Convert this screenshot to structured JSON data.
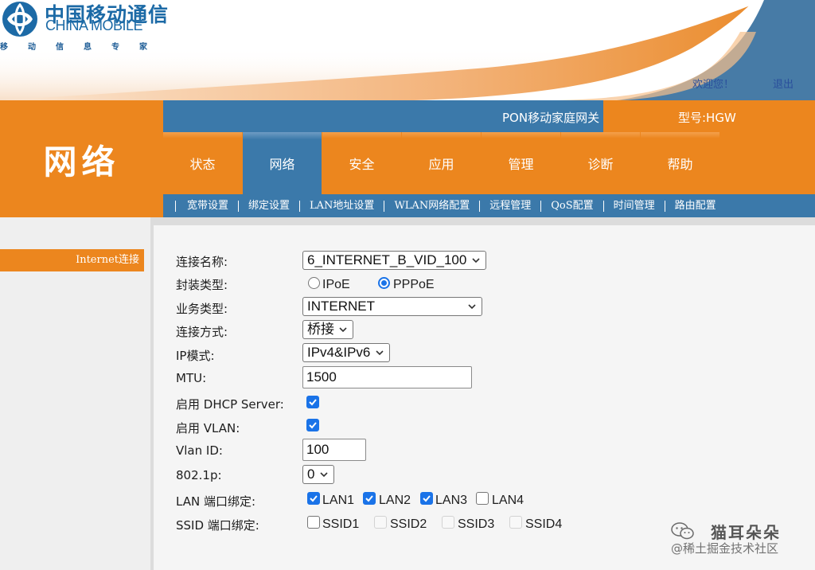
{
  "brand": {
    "name_cn": "中国移动通信",
    "name_en": "CHINA MOBILE",
    "slogan": [
      "移",
      "动",
      "信",
      "息",
      "专",
      "家"
    ],
    "primary_color": "#ec861e",
    "secondary_color": "#3b79aa"
  },
  "header": {
    "welcome": "欢迎您！",
    "logout": "退出",
    "device_name": "PON移动家庭网关",
    "model": "型号:HGW",
    "section_title": "网络"
  },
  "main_nav": [
    {
      "label": "状态",
      "active": false
    },
    {
      "label": "网络",
      "active": true
    },
    {
      "label": "安全",
      "active": false
    },
    {
      "label": "应用",
      "active": false
    },
    {
      "label": "管理",
      "active": false
    },
    {
      "label": "诊断",
      "active": false
    },
    {
      "label": "帮助",
      "active": false
    }
  ],
  "sub_nav": [
    {
      "label": "宽带设置",
      "active": true
    },
    {
      "label": "绑定设置",
      "active": false
    },
    {
      "label": "LAN地址设置",
      "active": false
    },
    {
      "label": "WLAN网络配置",
      "active": false
    },
    {
      "label": "远程管理",
      "active": false
    },
    {
      "label": "QoS配置",
      "active": false
    },
    {
      "label": "时间管理",
      "active": false
    },
    {
      "label": "路由配置",
      "active": false
    }
  ],
  "sidebar": {
    "items": [
      {
        "label": "Internet连接",
        "active": true
      }
    ]
  },
  "form": {
    "connection_name": {
      "label": "连接名称:",
      "value": "6_INTERNET_B_VID_100"
    },
    "encapsulation": {
      "label": "封装类型:",
      "options": [
        "IPoE",
        "PPPoE"
      ],
      "selected": "PPPoE"
    },
    "service_type": {
      "label": "业务类型:",
      "value": "INTERNET"
    },
    "connection_mode": {
      "label": "连接方式:",
      "value": "桥接"
    },
    "ip_mode": {
      "label": "IP模式:",
      "value": "IPv4&IPv6"
    },
    "mtu": {
      "label": "MTU:",
      "value": "1500"
    },
    "dhcp_server": {
      "label": "启用 DHCP Server:",
      "checked": true
    },
    "vlan": {
      "label": "启用 VLAN:",
      "checked": true
    },
    "vlan_id": {
      "label": "Vlan ID:",
      "value": "100"
    },
    "priority": {
      "label": "802.1p:",
      "value": "0"
    },
    "lan_binding": {
      "label": "LAN 端口绑定:",
      "ports": [
        {
          "name": "LAN1",
          "checked": true
        },
        {
          "name": "LAN2",
          "checked": true
        },
        {
          "name": "LAN3",
          "checked": true
        },
        {
          "name": "LAN4",
          "checked": false
        }
      ]
    },
    "ssid_binding": {
      "label": "SSID 端口绑定:",
      "ports": [
        {
          "name": "SSID1",
          "checked": false,
          "disabled": false
        },
        {
          "name": "SSID2",
          "checked": false,
          "disabled": true
        },
        {
          "name": "SSID3",
          "checked": false,
          "disabled": true
        },
        {
          "name": "SSID4",
          "checked": false,
          "disabled": true
        }
      ]
    }
  },
  "watermark": {
    "name": "猫耳朵朵",
    "sub": "@稀土掘金技术社区"
  }
}
